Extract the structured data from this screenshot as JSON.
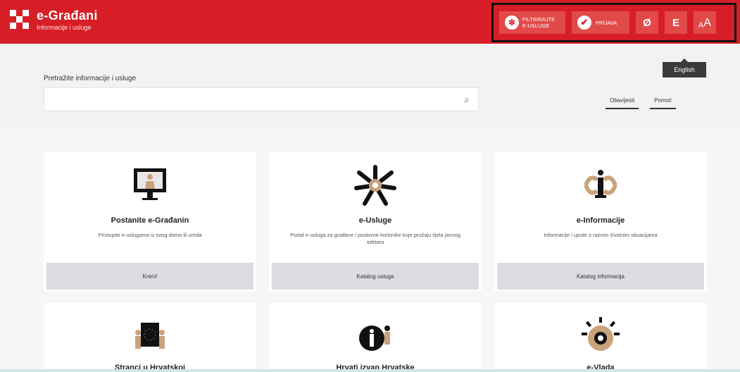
{
  "header": {
    "brand_title": "e-Građani",
    "brand_subtitle": "Informacije i usluge",
    "tools": {
      "filter_label_line1": "FILTRIRAJTE",
      "filter_label_line2": "E-USLUGE",
      "mode_label": "PRIJAVA",
      "mode_icon": "✔",
      "vision_icon": "Ø",
      "lang_icon": "E",
      "text_small": "A",
      "text_big": "A"
    },
    "tooltip": "English"
  },
  "search": {
    "label": "Pretražite informacije i usluge",
    "placeholder": "",
    "icon": "⌕"
  },
  "links": {
    "notices": "Obavijesti",
    "help": "Pomoć"
  },
  "cards": [
    {
      "title": "Postanite e-Građanin",
      "description": "Pristupite e-uslugama iz svog doma ili ureda",
      "button": "Kreni!"
    },
    {
      "title": "e-Usluge",
      "description": "Portal e-usluga za građane i poslovne korisnike koje pružaju tijela javnog sektora",
      "button": "Katalog usluga"
    },
    {
      "title": "e-Informacije",
      "description": "Informacije i upute o raznim životnim situacijama",
      "button": "Katalog informacija"
    },
    {
      "title": "Stranci u Hrvatskoj"
    },
    {
      "title": "Hrvati izvan Hrvatske"
    },
    {
      "title": "e-Vlada"
    }
  ],
  "colors": {
    "brand_red": "#d71e27",
    "card_button": "#dcdce2",
    "illustration_tan": "#c9a27a"
  }
}
